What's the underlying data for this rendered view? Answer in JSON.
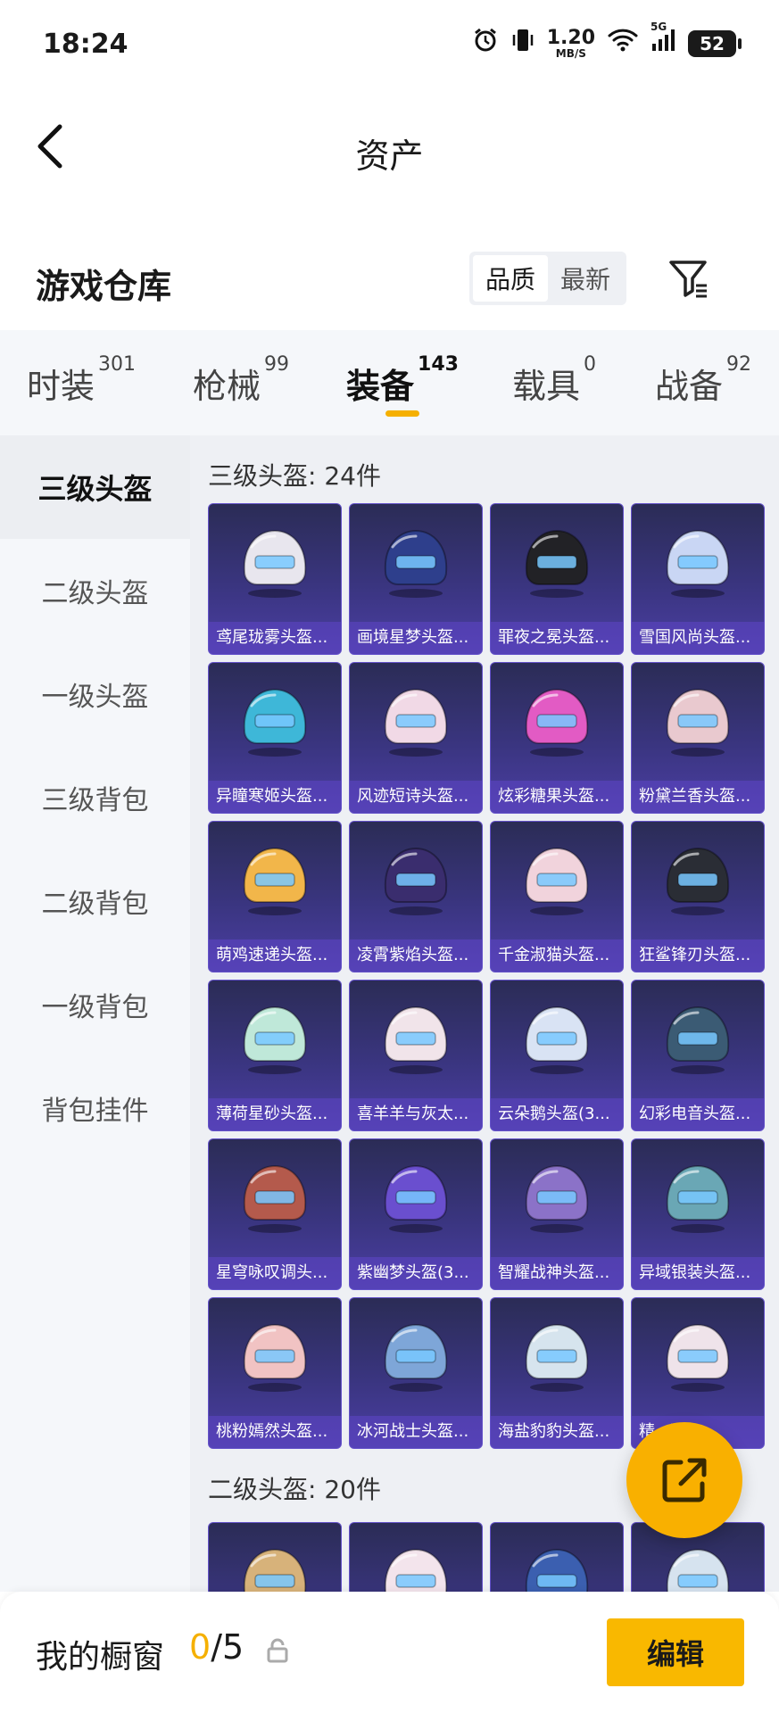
{
  "status": {
    "time": "18:24",
    "net_speed": "1.20",
    "net_unit": "MB/S",
    "network": "5G",
    "battery": "52"
  },
  "header": {
    "title": "资产"
  },
  "warehouse": {
    "title": "游戏仓库",
    "sort_options": [
      "品质",
      "最新"
    ],
    "sort_selected": "品质"
  },
  "tabs": [
    {
      "label": "时装",
      "count": "301"
    },
    {
      "label": "枪械",
      "count": "99"
    },
    {
      "label": "装备",
      "count": "143"
    },
    {
      "label": "载具",
      "count": "0"
    },
    {
      "label": "战备",
      "count": "92"
    }
  ],
  "active_tab": "装备",
  "sidebar": {
    "items": [
      "三级头盔",
      "二级头盔",
      "一级头盔",
      "三级背包",
      "二级背包",
      "一级背包",
      "背包挂件"
    ],
    "active": "三级头盔"
  },
  "sections": [
    {
      "title": "三级头盔: 24件",
      "items": [
        {
          "name": "鸢尾珑雾头盔...",
          "color": "#e8e6ee"
        },
        {
          "name": "画境星梦头盔...",
          "color": "#2e3f8c"
        },
        {
          "name": "罪夜之冕头盔...",
          "color": "#222226"
        },
        {
          "name": "雪国风尚头盔...",
          "color": "#c9d6f4"
        },
        {
          "name": "异瞳寒姬头盔...",
          "color": "#3eb7d8"
        },
        {
          "name": "风迹短诗头盔...",
          "color": "#f1d9e6"
        },
        {
          "name": "炫彩糖果头盔...",
          "color": "#e25bc4"
        },
        {
          "name": "粉黛兰香头盔...",
          "color": "#e9c9cf"
        },
        {
          "name": "萌鸡速递头盔...",
          "color": "#f2b64a"
        },
        {
          "name": "凌霄紫焰头盔...",
          "color": "#3a2d6e"
        },
        {
          "name": "千金淑猫头盔...",
          "color": "#f1d3dc"
        },
        {
          "name": "狂鲨锋刃头盔...",
          "color": "#2a2d35"
        },
        {
          "name": "薄荷星砂头盔...",
          "color": "#bfe8d9"
        },
        {
          "name": "喜羊羊与灰太...",
          "color": "#f1e4ea"
        },
        {
          "name": "云朵鹅头盔(3...",
          "color": "#d9e3f4"
        },
        {
          "name": "幻彩电音头盔...",
          "color": "#3b5b74"
        },
        {
          "name": "星穹咏叹调头...",
          "color": "#b45a4c"
        },
        {
          "name": "紫幽梦头盔(3...",
          "color": "#6a4fcf"
        },
        {
          "name": "智耀战神头盔...",
          "color": "#8b72c8"
        },
        {
          "name": "异域银装头盔...",
          "color": "#6aa7b5"
        },
        {
          "name": "桃粉嫣然头盔...",
          "color": "#f1c3c3"
        },
        {
          "name": "冰河战士头盔...",
          "color": "#7ea6d8"
        },
        {
          "name": "海盐豹豹头盔...",
          "color": "#d6e4ee"
        },
        {
          "name": "精...丽...",
          "color": "#efe3ea"
        }
      ]
    },
    {
      "title": "二级头盔: 20件",
      "items": [
        {
          "name": "",
          "color": "#d7b27a"
        },
        {
          "name": "",
          "color": "#f3e4ec"
        },
        {
          "name": "",
          "color": "#3b5fb0"
        },
        {
          "name": "",
          "color": "#d6e3ef"
        }
      ]
    }
  ],
  "showcase": {
    "title": "我的橱窗",
    "current": "0",
    "total": "/5",
    "edit_label": "编辑"
  }
}
